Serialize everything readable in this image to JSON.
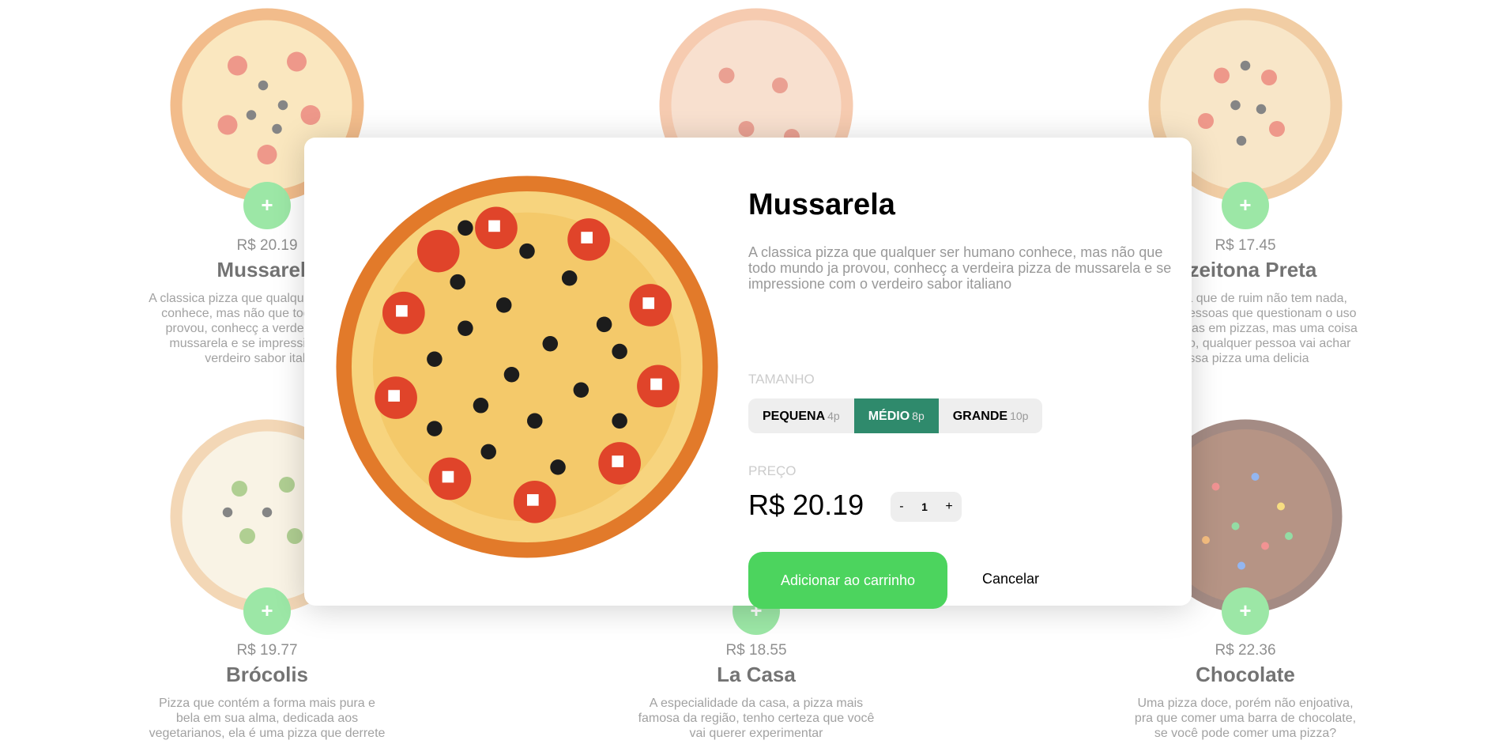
{
  "cards": [
    {
      "price": "R$ 20.19",
      "name": "Mussarela",
      "desc": "A classica pizza que qualquer ser humano conhece, mas não que todo mundo ja provou, conhecç a verdeira pizza de mussarela e se impressione com o verdeiro sabor italiano"
    },
    {
      "price": "",
      "name": "",
      "desc": ""
    },
    {
      "price": "R$ 17.45",
      "name": "Azeitona Preta",
      "desc": "Azeitona que de ruim não tem nada, existem pessoas que questionam o uso de azeitonas em pizzas, mas uma coisa eu te digo, qualquer pessoa vai achar essa pizza uma delicia"
    },
    {
      "price": "R$ 19.77",
      "name": "Brócolis",
      "desc": "Pizza que contém a forma mais pura e bela em sua alma, dedicada aos vegetarianos, ela é uma pizza que derrete"
    },
    {
      "price": "R$ 18.55",
      "name": "La Casa",
      "desc": "A especialidade da casa, a pizza mais famosa da região, tenho certeza que você vai querer experimentar"
    },
    {
      "price": "R$ 22.36",
      "name": "Chocolate",
      "desc": "Uma pizza doce, porém não enjoativa, pra que comer uma barra de chocolate, se você pode comer uma pizza?"
    }
  ],
  "add_symbol": "+",
  "modal": {
    "title": "Mussarela",
    "desc": "A classica pizza que qualquer ser humano conhece, mas não que todo mundo ja provou, conhecç a verdeira pizza de mussarela e se impressione com o verdeiro sabor italiano",
    "size_label": "Tamanho",
    "sizes": [
      {
        "label": "PEQUENA",
        "pieces": "4p"
      },
      {
        "label": "MÉDIO",
        "pieces": "8p"
      },
      {
        "label": "GRANDE",
        "pieces": "10p"
      }
    ],
    "selected_size": "MÉDIO",
    "price_label": "Preço",
    "price": "R$ 20.19",
    "qty_minus": "-",
    "qty_value": "1",
    "qty_plus": "+",
    "add_to_cart": "Adicionar ao carrinho",
    "cancel": "Cancelar"
  },
  "colors": {
    "accent_green": "#4cd45e",
    "selected_size": "#2f8a6c"
  }
}
